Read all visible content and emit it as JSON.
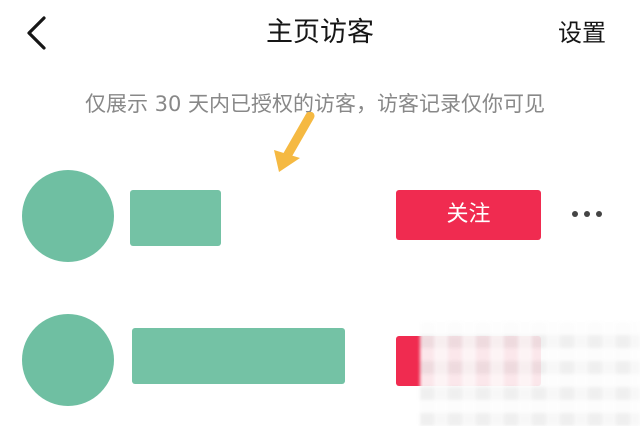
{
  "header": {
    "back_icon": "chevron-left-icon",
    "title": "主页访客",
    "settings_label": "设置"
  },
  "notice": {
    "text": "仅展示 30 天内已授权的访客，访客记录仅你可见"
  },
  "annotation": {
    "icon": "pointer-arrow-icon",
    "color": "#f5b942"
  },
  "visitors": [
    {
      "follow_label": "关注",
      "more_icon": "more-icon"
    },
    {
      "follow_label": ""
    }
  ],
  "colors": {
    "avatar": "#6fbfa2",
    "follow_button": "#f02b50",
    "text_primary": "#161616",
    "text_secondary": "#888888"
  }
}
